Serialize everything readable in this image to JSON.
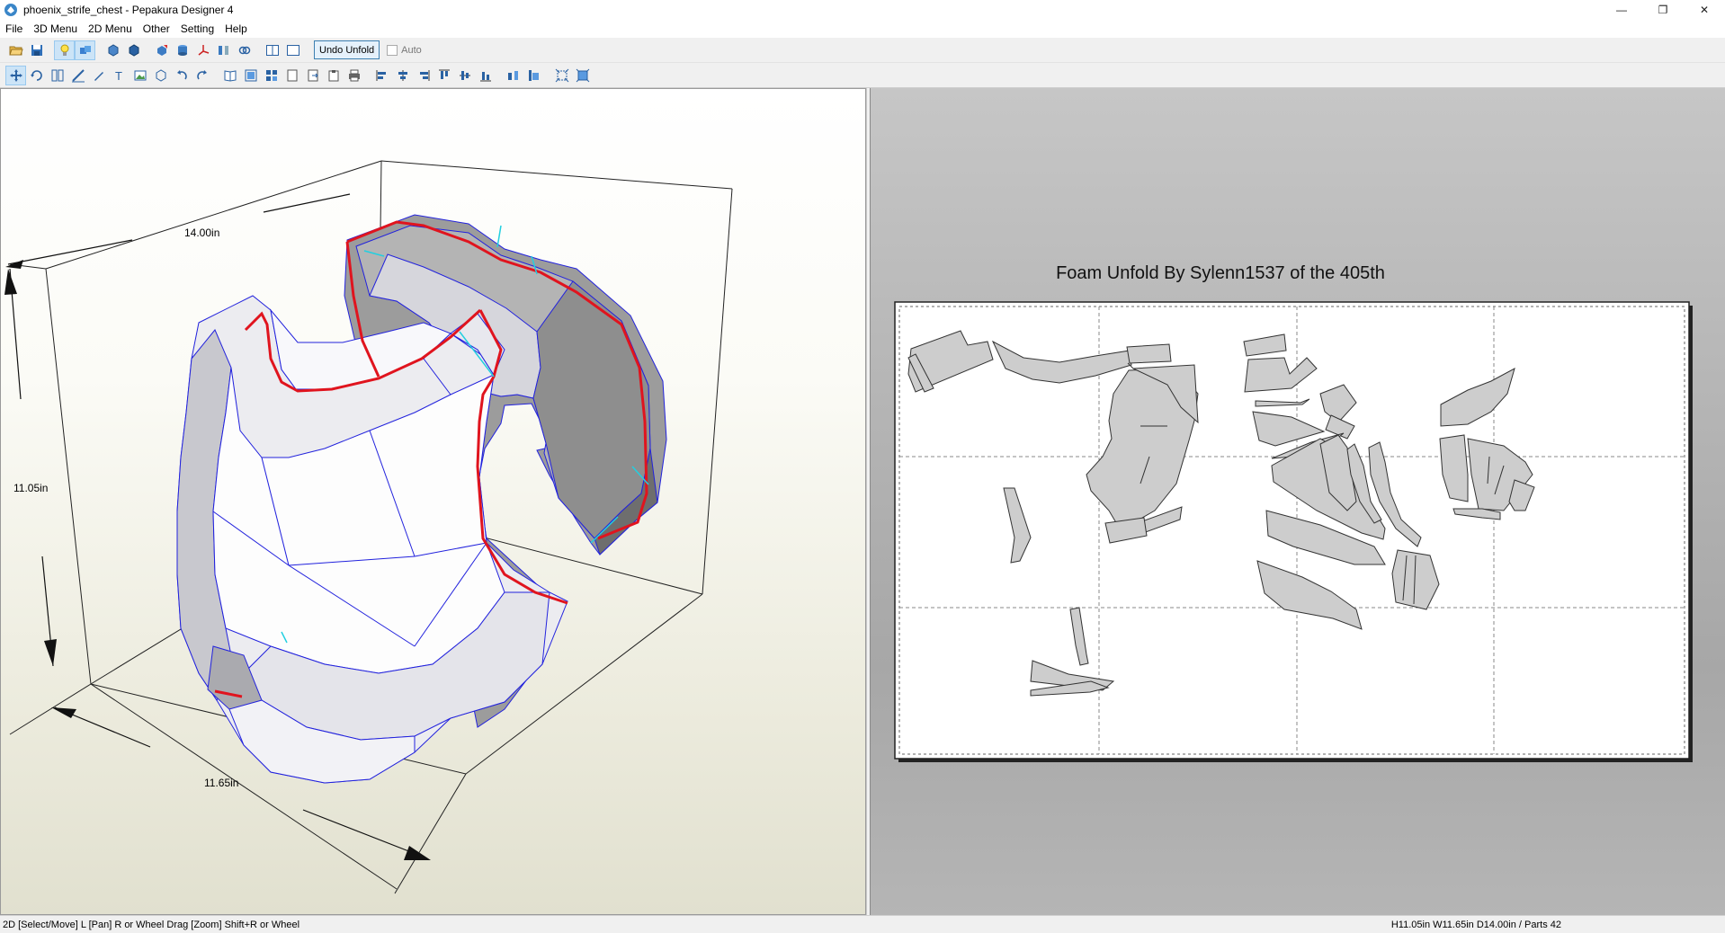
{
  "window": {
    "title": "phoenix_strife_chest - Pepakura Designer 4",
    "minimize_glyph": "—",
    "maximize_glyph": "❐",
    "close_glyph": "✕"
  },
  "menu": [
    "File",
    "3D Menu",
    "2D Menu",
    "Other",
    "Setting",
    "Help"
  ],
  "toolbar": {
    "undo_unfold_label": "Undo Unfold",
    "auto_label": "Auto",
    "auto_checked": false
  },
  "view3d": {
    "dim_width": "14.00in",
    "dim_height": "11.05in",
    "dim_depth": "11.65in"
  },
  "view2d": {
    "title": "Foam Unfold By Sylenn1537 of the 405th"
  },
  "status": {
    "left": "2D [Select/Move] L [Pan] R or Wheel Drag [Zoom] Shift+R or Wheel",
    "right": "H11.05in W11.65in D14.00in / Parts 42"
  },
  "colors": {
    "model_edge": "#2222dd",
    "cut_edge": "#e0141e",
    "fold_edge": "#22cfe0",
    "part_fill": "#cdcdcd"
  }
}
